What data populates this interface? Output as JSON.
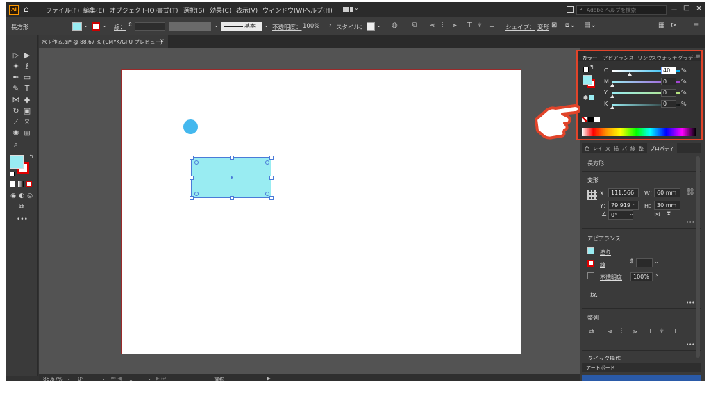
{
  "menubar": {
    "app_logo": "Ai",
    "items": [
      "ファイル(F)",
      "編集(E)",
      "オブジェクト(O)",
      "書式(T)",
      "選択(S)",
      "効果(C)",
      "表示(V)",
      "ウィンドウ(W)",
      "ヘルプ(H)"
    ],
    "search_placeholder": "Adobe ヘルプを検索",
    "window_controls": [
      "－",
      "□",
      "×"
    ]
  },
  "controlbar": {
    "object_type": "長方形",
    "stroke_label": "線：",
    "stroke_style": "基本",
    "opacity_label": "不透明度：",
    "opacity_value": "100%",
    "style_label": "スタイル：",
    "shape_label": "シェイプ：",
    "transform_label": "変形"
  },
  "document_tab": {
    "title": "水玉作る.ai* @ 88.67 % (CMYK/GPU プレビュー)",
    "close": "×"
  },
  "color_panel": {
    "tabs": [
      "カラー",
      "アピアランス",
      "リンク",
      "スウォッチ",
      "グラデー"
    ],
    "sliders": [
      {
        "label": "C",
        "value": "40",
        "level": 0.4
      },
      {
        "label": "M",
        "value": "0",
        "level": 0.0
      },
      {
        "label": "Y",
        "value": "0",
        "level": 0.0
      },
      {
        "label": "K",
        "value": "0",
        "level": 0.0
      }
    ],
    "percent": "%"
  },
  "properties": {
    "tabs": [
      "色",
      "レイ",
      "文",
      "描",
      "パ",
      "線",
      "整",
      "プロパティ"
    ],
    "object_type": "長方形",
    "transform_title": "変形",
    "x_label": "X：",
    "x_value": "111.566",
    "y_label": "Y：",
    "y_value": "79.919 r",
    "w_label": "W：",
    "w_value": "60 mm",
    "h_label": "H：",
    "h_value": "30 mm",
    "angle_value": "0°",
    "appearance_title": "アピアランス",
    "fill_label": "塗り",
    "stroke_label": "線",
    "opacity_label": "不透明度",
    "opacity_value": "100%",
    "fx_label": "fx.",
    "align_title": "整列",
    "quick_actions_title": "クイック操作",
    "artboard_panel_title": "アートボード"
  },
  "statusbar": {
    "zoom": "88.67%",
    "rotation": "0°",
    "artboard_num": "1",
    "mode": "選択"
  },
  "colors": {
    "accent_red": "#e1442a",
    "fill_cyan": "#99ecf2",
    "circle_blue": "#44b8ee",
    "selection_blue": "#4a7bd8"
  }
}
